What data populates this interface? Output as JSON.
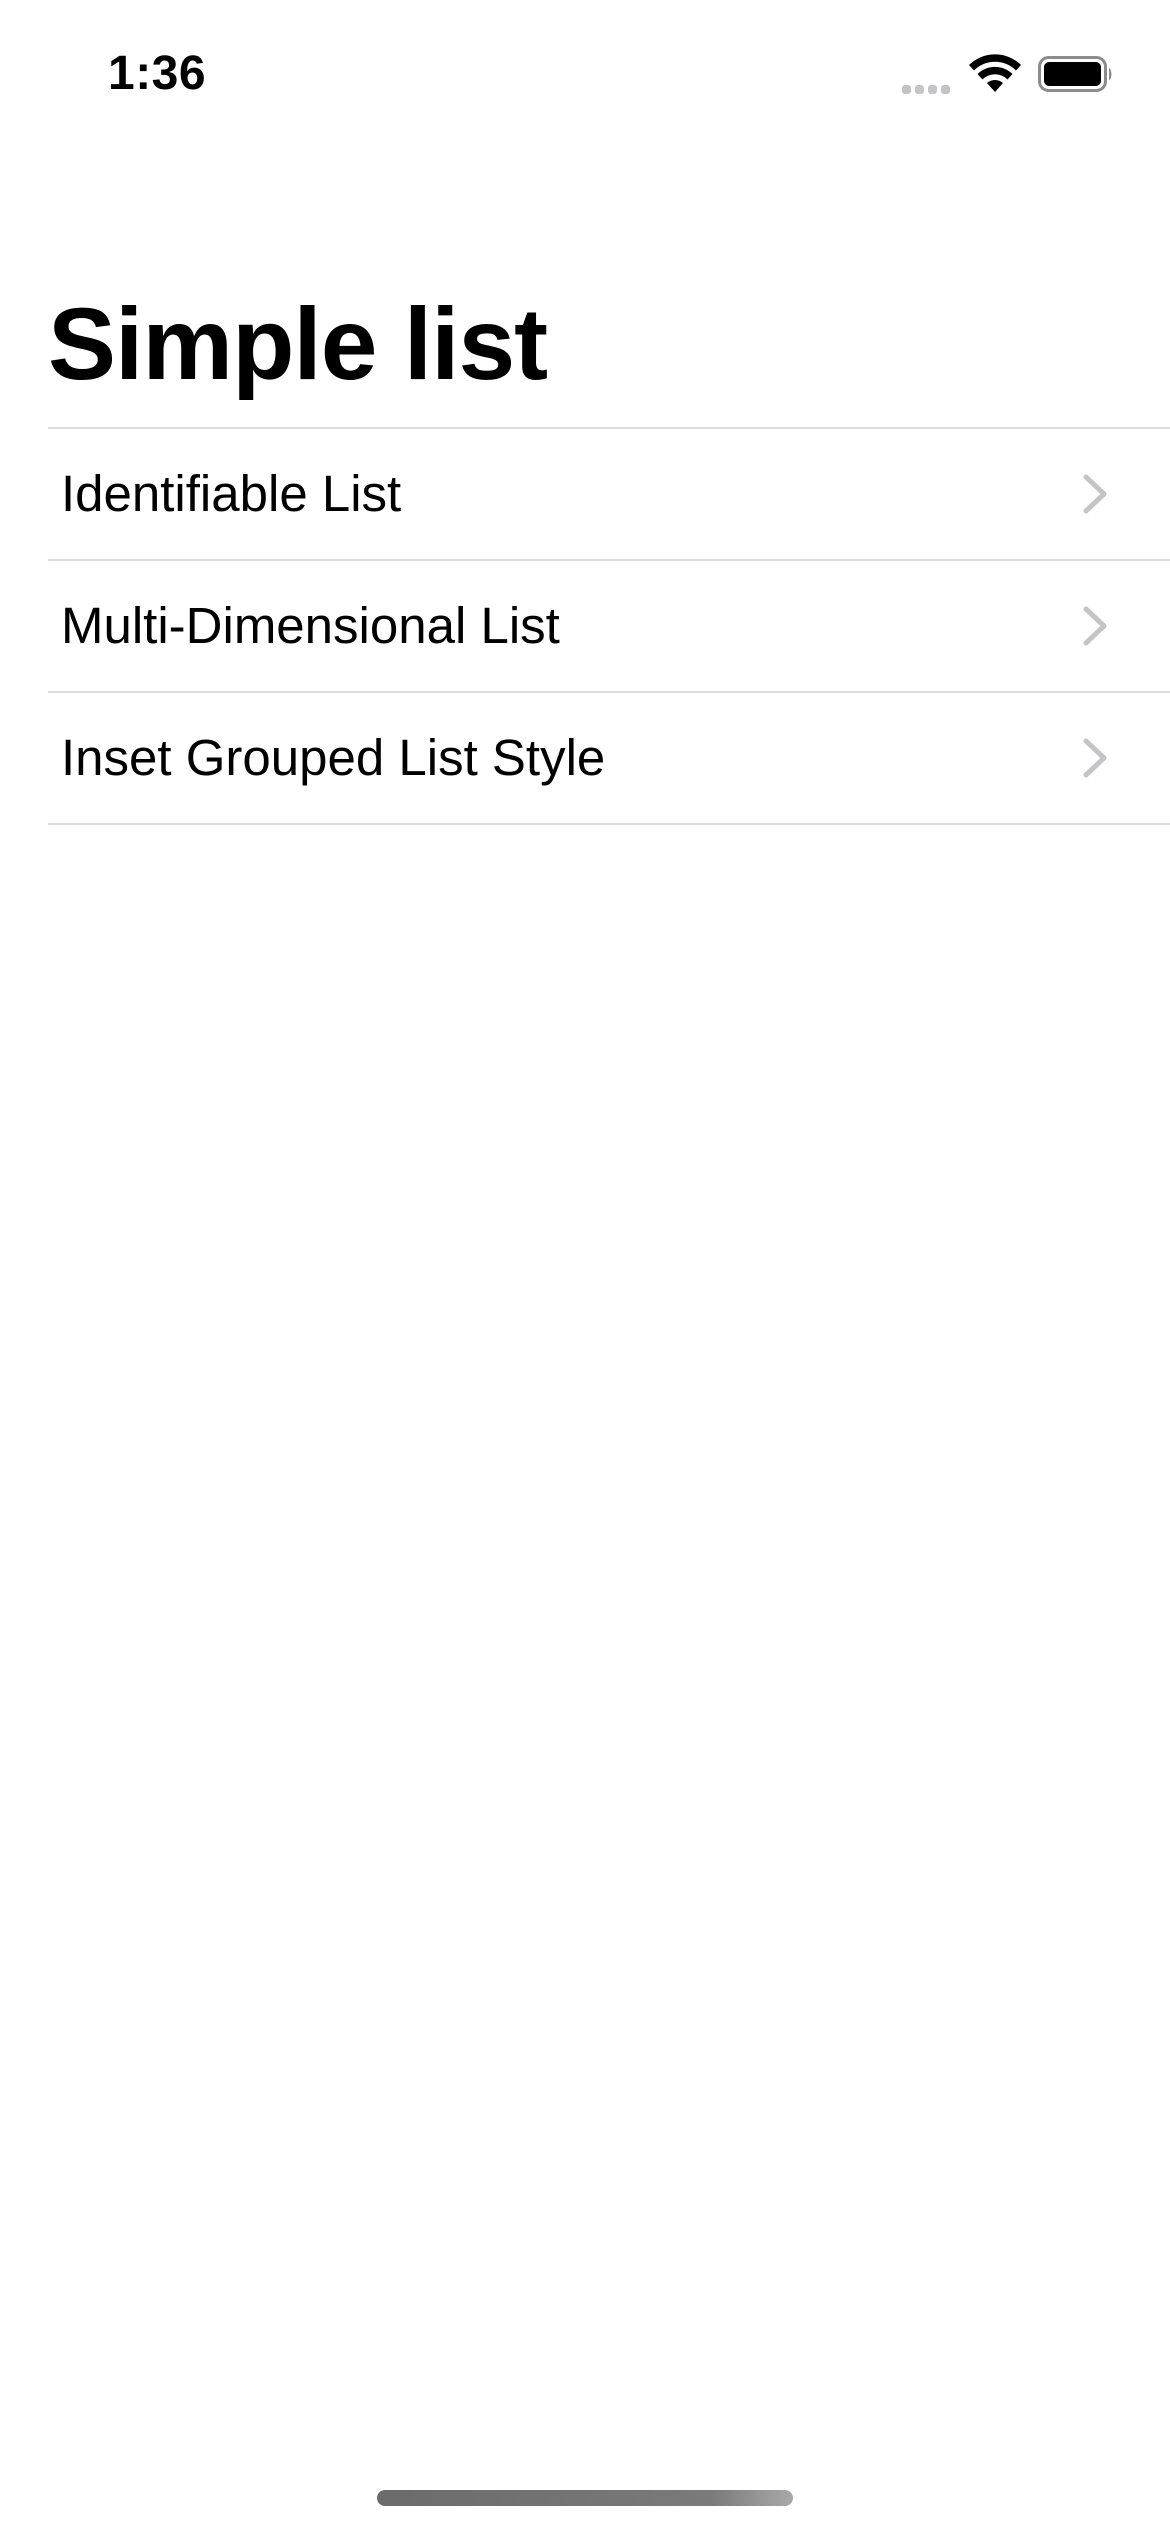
{
  "status_bar": {
    "time": "1:36",
    "signal_icon": "cellular-signal-icon",
    "wifi_icon": "wifi-icon",
    "battery_icon": "battery-icon"
  },
  "navigation": {
    "title": "Simple list"
  },
  "list": {
    "items": [
      {
        "label": "Identifiable List",
        "icon": "chevron-right-icon"
      },
      {
        "label": "Multi-Dimensional List",
        "icon": "chevron-right-icon"
      },
      {
        "label": "Inset Grouped List Style",
        "icon": "chevron-right-icon"
      }
    ]
  },
  "colors": {
    "background": "#ffffff",
    "text": "#000000",
    "separator": "#dcdce0",
    "chevron": "#c4c4c7"
  }
}
